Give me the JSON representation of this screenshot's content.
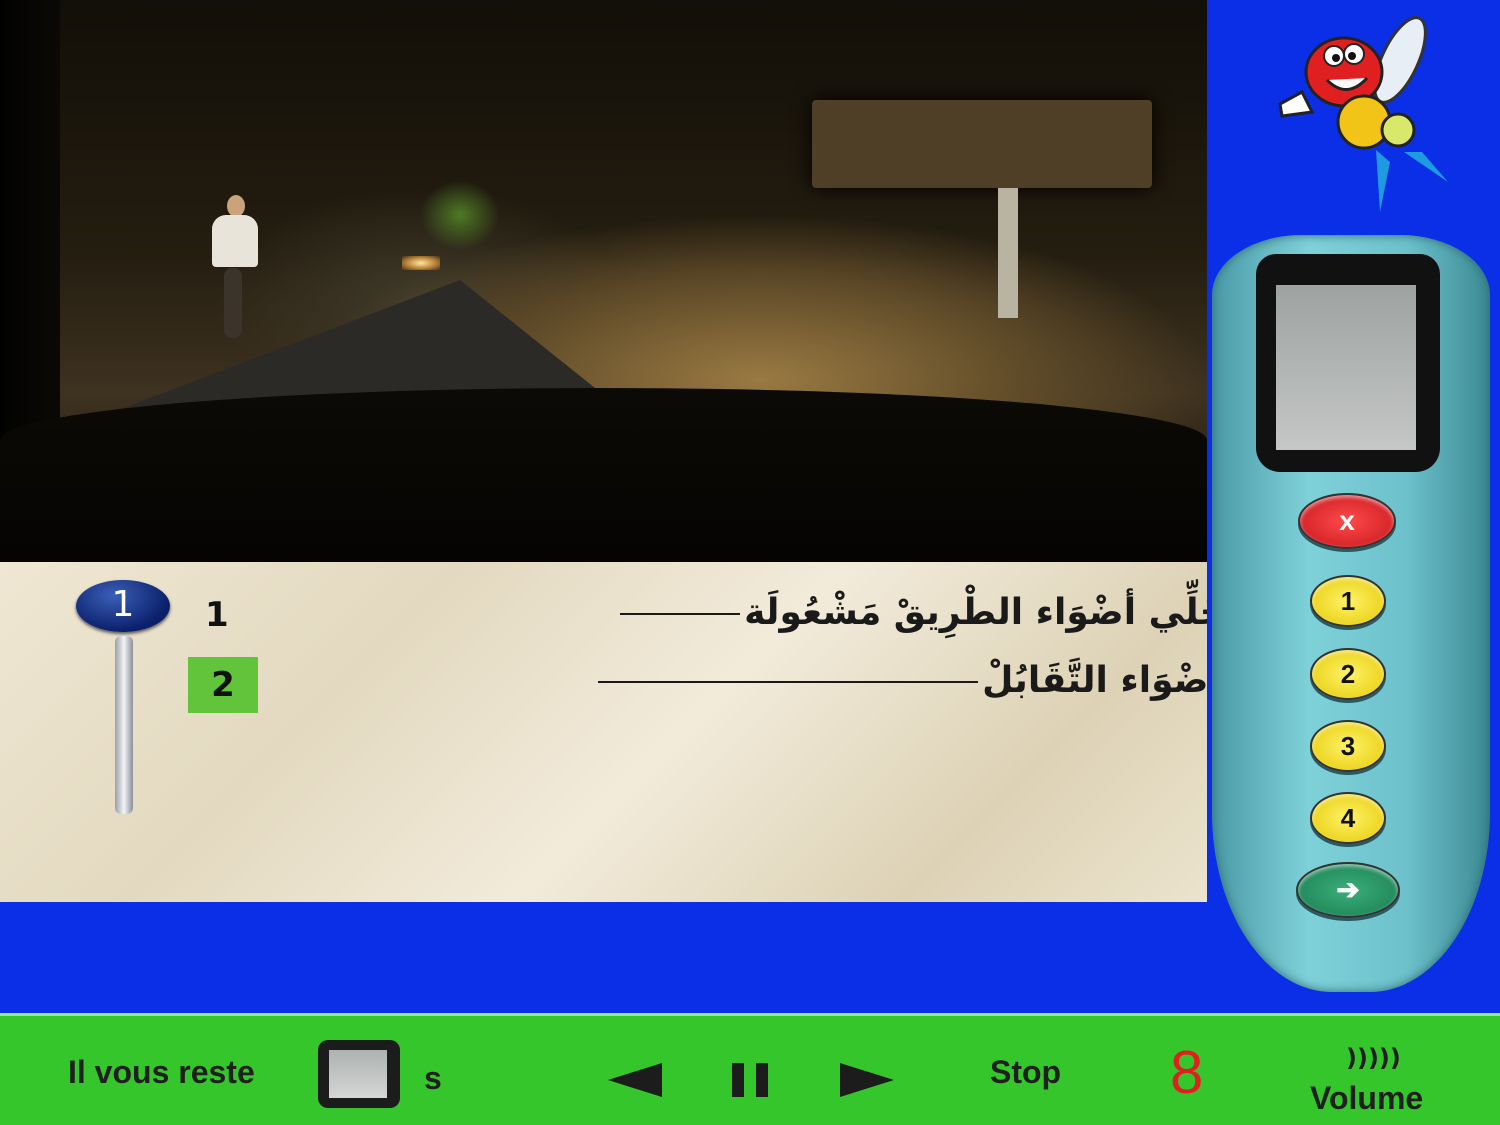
{
  "question": {
    "number": "1",
    "answers": [
      {
        "number": "1",
        "text": "ـ يَمْكَنْ لِي نَخَلِّي أضْوَاء الطْرِيقْ مَشْعُولَة"
      },
      {
        "number": "2",
        "text": "ـ لاَزَمْ نْغَيّرْ لِأَضْوَاء التَّقَابُلْ"
      }
    ]
  },
  "remote": {
    "cancel_label": "x",
    "buttons": [
      "1",
      "2",
      "3",
      "4"
    ],
    "confirm_label": "➔"
  },
  "bottom_bar": {
    "remaining_label": "Il vous reste",
    "seconds_label": "s",
    "stop_label": "Stop",
    "question_counter": "8",
    "volume_label": "Volume",
    "volume_icon_glyph": ")))))"
  },
  "colors": {
    "background": "#0a2fe6",
    "bottom_bar": "#35c62c",
    "counter": "#e02020",
    "selected_answer": "#62c43a"
  }
}
